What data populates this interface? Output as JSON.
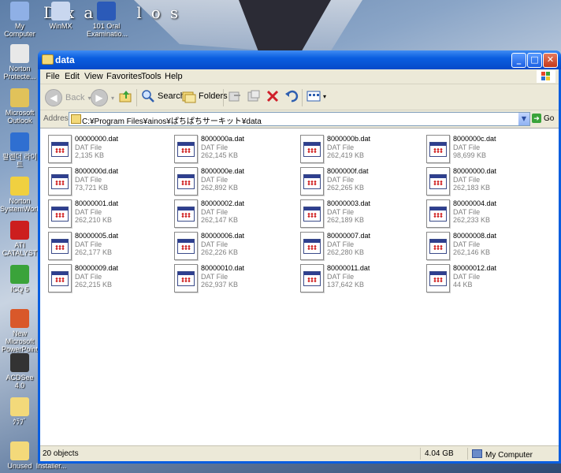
{
  "desktop": {
    "banner": "Dxab los",
    "icons": [
      {
        "label": "My Computer",
        "color": "#8fb0e6"
      },
      {
        "label": "WinMX",
        "color": "#c9d7ef"
      },
      {
        "label": "101 Oral Examinatio...",
        "color": "#2b5ab8"
      },
      {
        "label": "Norton Protecte...",
        "color": "#e8e8e8"
      },
      {
        "label": "Microsoft Outlook",
        "color": "#e1c25a"
      },
      {
        "label": "팔렌더 라이트",
        "color": "#2f6fd1"
      },
      {
        "label": "Norton SystemWorks",
        "color": "#f0d040"
      },
      {
        "label": "ATI CATALYST",
        "color": "#cc1e1e"
      },
      {
        "label": "ICQ 5",
        "color": "#3aa33a"
      },
      {
        "label": "New Microsoft PowerPoint ...",
        "color": "#d9582a"
      },
      {
        "label": "ACDSee 4.0",
        "color": "#333333"
      },
      {
        "label": "ｸﾗﾌﾞ",
        "color": "#f3d97a"
      },
      {
        "label": "Unused",
        "color": "#f3d97a"
      },
      {
        "label": "Installer...",
        "color": "#f3d97a"
      }
    ]
  },
  "window": {
    "title": "data",
    "menu": [
      "File",
      "Edit",
      "View",
      "Favorites",
      "Tools",
      "Help"
    ],
    "toolbar": {
      "back": "Back",
      "forward": "",
      "search": "Search",
      "folders": "Folders"
    },
    "address_label": "Address",
    "address": "C:¥Program Files¥ainos¥ぱちぱちサーキット¥data",
    "go": "Go"
  },
  "files": [
    {
      "name": "00000000.dat",
      "type": "DAT File",
      "size": "2,135 KB"
    },
    {
      "name": "8000000a.dat",
      "type": "DAT File",
      "size": "262,145 KB"
    },
    {
      "name": "8000000b.dat",
      "type": "DAT File",
      "size": "262,419 KB"
    },
    {
      "name": "8000000c.dat",
      "type": "DAT File",
      "size": "98,699 KB"
    },
    {
      "name": "8000000d.dat",
      "type": "DAT File",
      "size": "73,721 KB"
    },
    {
      "name": "8000000e.dat",
      "type": "DAT File",
      "size": "262,892 KB"
    },
    {
      "name": "8000000f.dat",
      "type": "DAT File",
      "size": "262,265 KB"
    },
    {
      "name": "80000000.dat",
      "type": "DAT File",
      "size": "262,183 KB"
    },
    {
      "name": "80000001.dat",
      "type": "DAT File",
      "size": "262,210 KB"
    },
    {
      "name": "80000002.dat",
      "type": "DAT File",
      "size": "262,147 KB"
    },
    {
      "name": "80000003.dat",
      "type": "DAT File",
      "size": "262,189 KB"
    },
    {
      "name": "80000004.dat",
      "type": "DAT File",
      "size": "262,233 KB"
    },
    {
      "name": "80000005.dat",
      "type": "DAT File",
      "size": "262,177 KB"
    },
    {
      "name": "80000006.dat",
      "type": "DAT File",
      "size": "262,226 KB"
    },
    {
      "name": "80000007.dat",
      "type": "DAT File",
      "size": "262,280 KB"
    },
    {
      "name": "80000008.dat",
      "type": "DAT File",
      "size": "262,146 KB"
    },
    {
      "name": "80000009.dat",
      "type": "DAT File",
      "size": "262,215 KB"
    },
    {
      "name": "80000010.dat",
      "type": "DAT File",
      "size": "262,937 KB"
    },
    {
      "name": "80000011.dat",
      "type": "DAT File",
      "size": "137,642 KB"
    },
    {
      "name": "80000012.dat",
      "type": "DAT File",
      "size": "44 KB"
    }
  ],
  "status": {
    "objects": "20 objects",
    "size": "4.04 GB",
    "location": "My Computer"
  }
}
